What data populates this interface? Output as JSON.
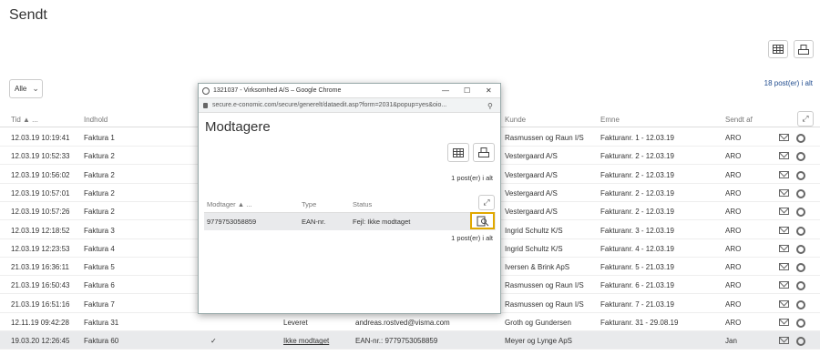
{
  "page": {
    "title": "Sendt",
    "filter": "Alle",
    "count": "18 post(er) i alt",
    "icons": {
      "table": "table-icon",
      "print": "print-icon",
      "expand": "expand-icon"
    }
  },
  "table": {
    "headers": {
      "tid": "Tid ▲ ...",
      "indhold": "Indhold",
      "kunde": "Kunde",
      "emne": "Emne",
      "sendt_af": "Sendt af"
    },
    "rows": [
      {
        "tid": "12.03.19 10:19:41",
        "indhold": "Faktura 1",
        "status": "",
        "status_text": "",
        "modtager": "",
        "kunde": "Rasmussen og Raun I/S",
        "emne": "Fakturanr. 1 - 12.03.19",
        "sendt_af": "ARO"
      },
      {
        "tid": "12.03.19 10:52:33",
        "indhold": "Faktura 2",
        "status": "",
        "status_text": "",
        "modtager": "",
        "kunde": "Vestergaard A/S",
        "emne": "Fakturanr. 2 - 12.03.19",
        "sendt_af": "ARO"
      },
      {
        "tid": "12.03.19 10:56:02",
        "indhold": "Faktura 2",
        "status": "",
        "status_text": "",
        "modtager": "",
        "kunde": "Vestergaard A/S",
        "emne": "Fakturanr. 2 - 12.03.19",
        "sendt_af": "ARO"
      },
      {
        "tid": "12.03.19 10:57:01",
        "indhold": "Faktura 2",
        "status": "",
        "status_text": "",
        "modtager": "",
        "kunde": "Vestergaard A/S",
        "emne": "Fakturanr. 2 - 12.03.19",
        "sendt_af": "ARO"
      },
      {
        "tid": "12.03.19 10:57:26",
        "indhold": "Faktura 2",
        "status": "",
        "status_text": "",
        "modtager": "",
        "kunde": "Vestergaard A/S",
        "emne": "Fakturanr. 2 - 12.03.19",
        "sendt_af": "ARO"
      },
      {
        "tid": "12.03.19 12:18:52",
        "indhold": "Faktura 3",
        "status": "",
        "status_text": "",
        "modtager": "",
        "kunde": "Ingrid Schultz K/S",
        "emne": "Fakturanr. 3 - 12.03.19",
        "sendt_af": "ARO"
      },
      {
        "tid": "12.03.19 12:23:53",
        "indhold": "Faktura 4",
        "status": "",
        "status_text": "",
        "modtager": "",
        "kunde": "Ingrid Schultz K/S",
        "emne": "Fakturanr. 4 - 12.03.19",
        "sendt_af": "ARO"
      },
      {
        "tid": "21.03.19 16:36:11",
        "indhold": "Faktura 5",
        "status": "",
        "status_text": "",
        "modtager": "",
        "kunde": "Iversen & Brink ApS",
        "emne": "Fakturanr. 5 - 21.03.19",
        "sendt_af": "ARO"
      },
      {
        "tid": "21.03.19 16:50:43",
        "indhold": "Faktura 6",
        "status": "",
        "status_text": "",
        "modtager": "",
        "kunde": "Rasmussen og Raun I/S",
        "emne": "Fakturanr. 6 - 21.03.19",
        "sendt_af": "ARO"
      },
      {
        "tid": "21.03.19 16:51:16",
        "indhold": "Faktura 7",
        "status": "",
        "status_text": "",
        "modtager": "",
        "kunde": "Rasmussen og Raun I/S",
        "emne": "Fakturanr. 7 - 21.03.19",
        "sendt_af": "ARO"
      },
      {
        "tid": "12.11.19 09:42:28",
        "indhold": "Faktura 31",
        "status": "",
        "status_text": "Leveret",
        "modtager": "andreas.rostved@visma.com",
        "kunde": "Groth og Gundersen",
        "emne": "Fakturanr. 31 - 29.08.19",
        "sendt_af": "ARO"
      },
      {
        "tid": "19.03.20 12:26:45",
        "indhold": "Faktura 60",
        "status": "✓",
        "status_text": "Ikke modtaget",
        "modtager": "EAN-nr.: 9779753058859",
        "kunde": "Meyer og Lynge ApS",
        "emne": "",
        "sendt_af": "Jan"
      }
    ]
  },
  "popup": {
    "window_title": "1321037 - Virksomhed A/S – Google Chrome",
    "url": "secure.e-conomic.com/secure/generelt/dataedit.asp?form=2031&popup=yes&oio...",
    "heading": "Modtagere",
    "count_top": "1 post(er) i alt",
    "count_bottom": "1 post(er) i alt",
    "headers": {
      "modtager": "Modtager ▲ ...",
      "type": "Type",
      "status": "Status"
    },
    "row": {
      "modtager": "9779753058859",
      "type": "EAN-nr.",
      "status": "Fejl: Ikke modtaget"
    },
    "controls": {
      "minimize": "—",
      "maximize": "☐",
      "close": "✕"
    },
    "icons": {
      "lock": "lock-icon",
      "zoom": "zoom-icon",
      "view": "view-document-icon"
    }
  }
}
